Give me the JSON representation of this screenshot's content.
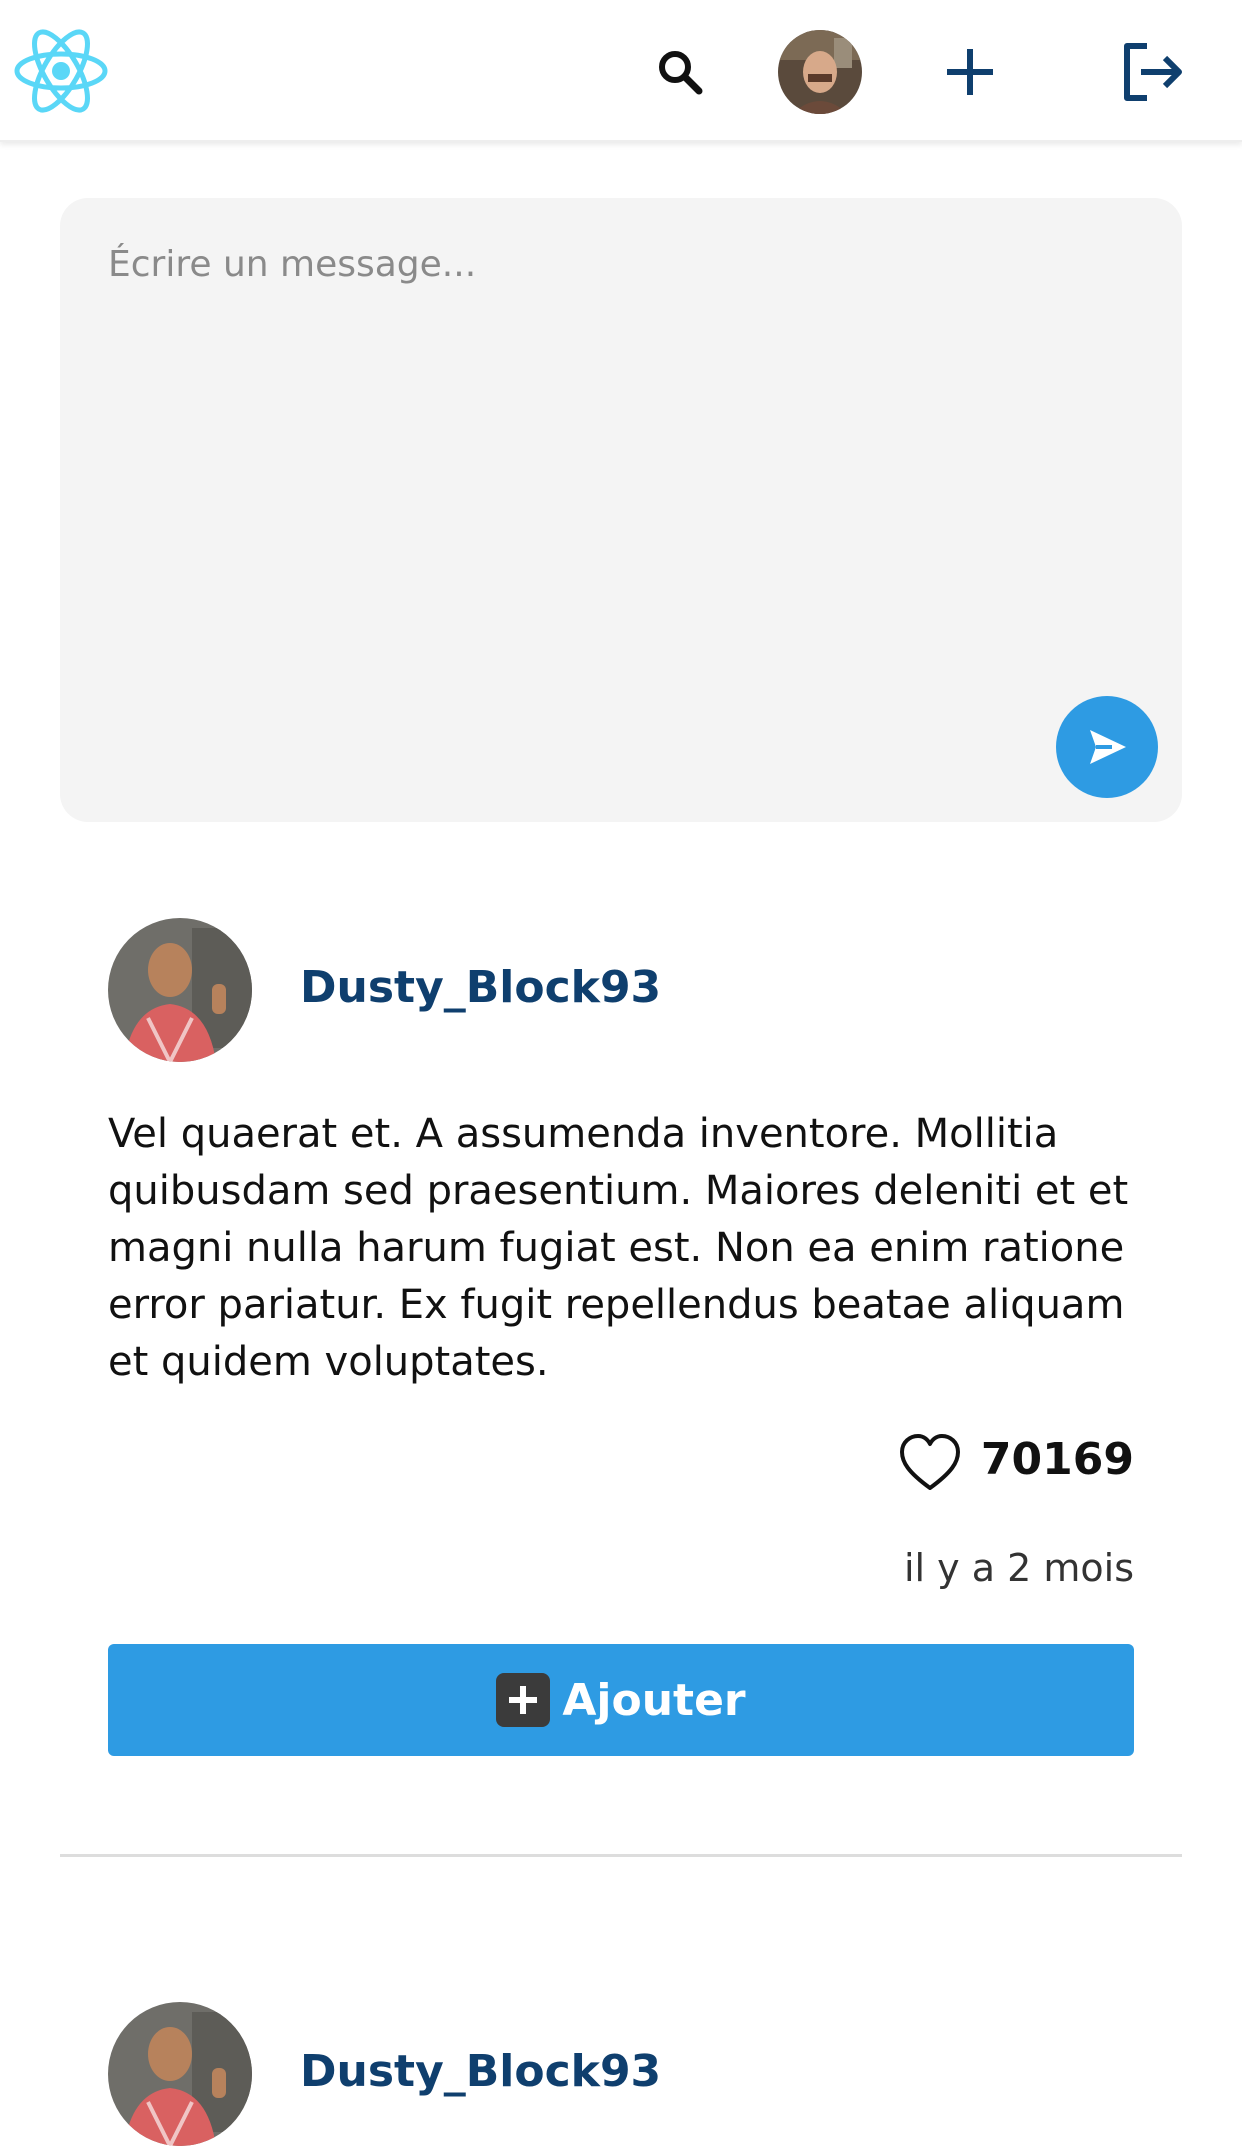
{
  "header": {
    "logo_icon": "react-atom-icon",
    "search_icon": "search-icon",
    "add_icon": "plus-icon",
    "logout_icon": "logout-icon",
    "accent_color": "#5ad7f7",
    "icon_color": "#0f3f6e"
  },
  "composer": {
    "placeholder": "Écrire un message...",
    "send_icon": "send-icon",
    "accent_color": "#2e9be3"
  },
  "posts": [
    {
      "author": "Dusty_Block93",
      "body": "Vel quaerat et. A assumenda inventore. Mollitia quibusdam sed praesentium. Maiores deleniti et et magni nulla harum fugiat est. Non ea enim ratione error pariatur. Ex fugit repellendus beatae aliquam et quidem voluptates.",
      "likes": "70169",
      "time": "il y a 2 mois",
      "add_label": "Ajouter"
    },
    {
      "author": "Dusty_Block93"
    }
  ]
}
